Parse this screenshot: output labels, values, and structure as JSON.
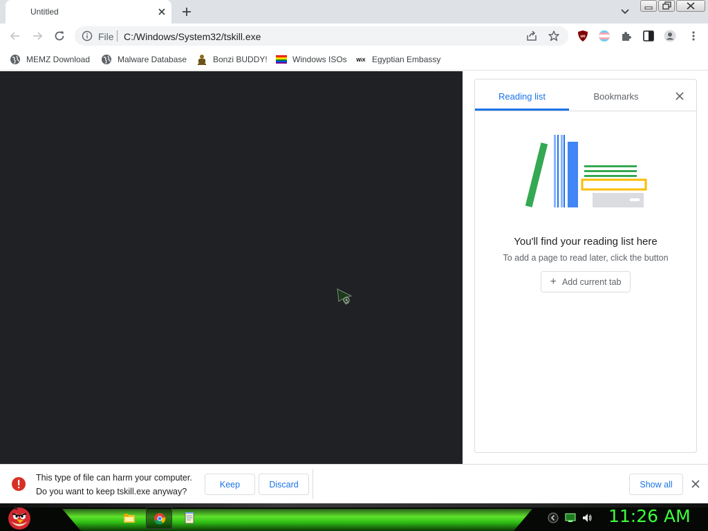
{
  "tab": {
    "title": "Untitled"
  },
  "omnibox": {
    "scheme_label": "File",
    "url": "C:/Windows/System32/tskill.exe"
  },
  "bookmarks": [
    {
      "label": "MEMZ Download",
      "icon": "globe-icon"
    },
    {
      "label": "Malware Database",
      "icon": "globe-icon"
    },
    {
      "label": "Bonzi BUDDY!",
      "icon": "bonzi-icon"
    },
    {
      "label": "Windows ISOs",
      "icon": "windows-flag-icon"
    },
    {
      "label": "Egyptian Embassy",
      "icon": "wix-icon"
    }
  ],
  "side_panel": {
    "tabs": [
      {
        "label": "Reading list"
      },
      {
        "label": "Bookmarks"
      }
    ],
    "active_tab": "Reading list",
    "empty_title": "You'll find your reading list here",
    "empty_subtitle": "To add a page to read later, click the button",
    "add_button_label": "Add current tab"
  },
  "download_shelf": {
    "warning_line1": "This type of file can harm your computer.",
    "warning_line2": "Do you want to keep tskill.exe anyway?",
    "keep_label": "Keep",
    "discard_label": "Discard",
    "show_all_label": "Show all"
  },
  "taskbar": {
    "clock": "11:26 AM",
    "items": [
      "file-explorer-icon",
      "chrome-icon",
      "notepad-icon"
    ]
  },
  "colors": {
    "accent": "#1a73e8",
    "content_bg": "#202124",
    "clock": "#3cff3c",
    "warning": "#d93025"
  }
}
